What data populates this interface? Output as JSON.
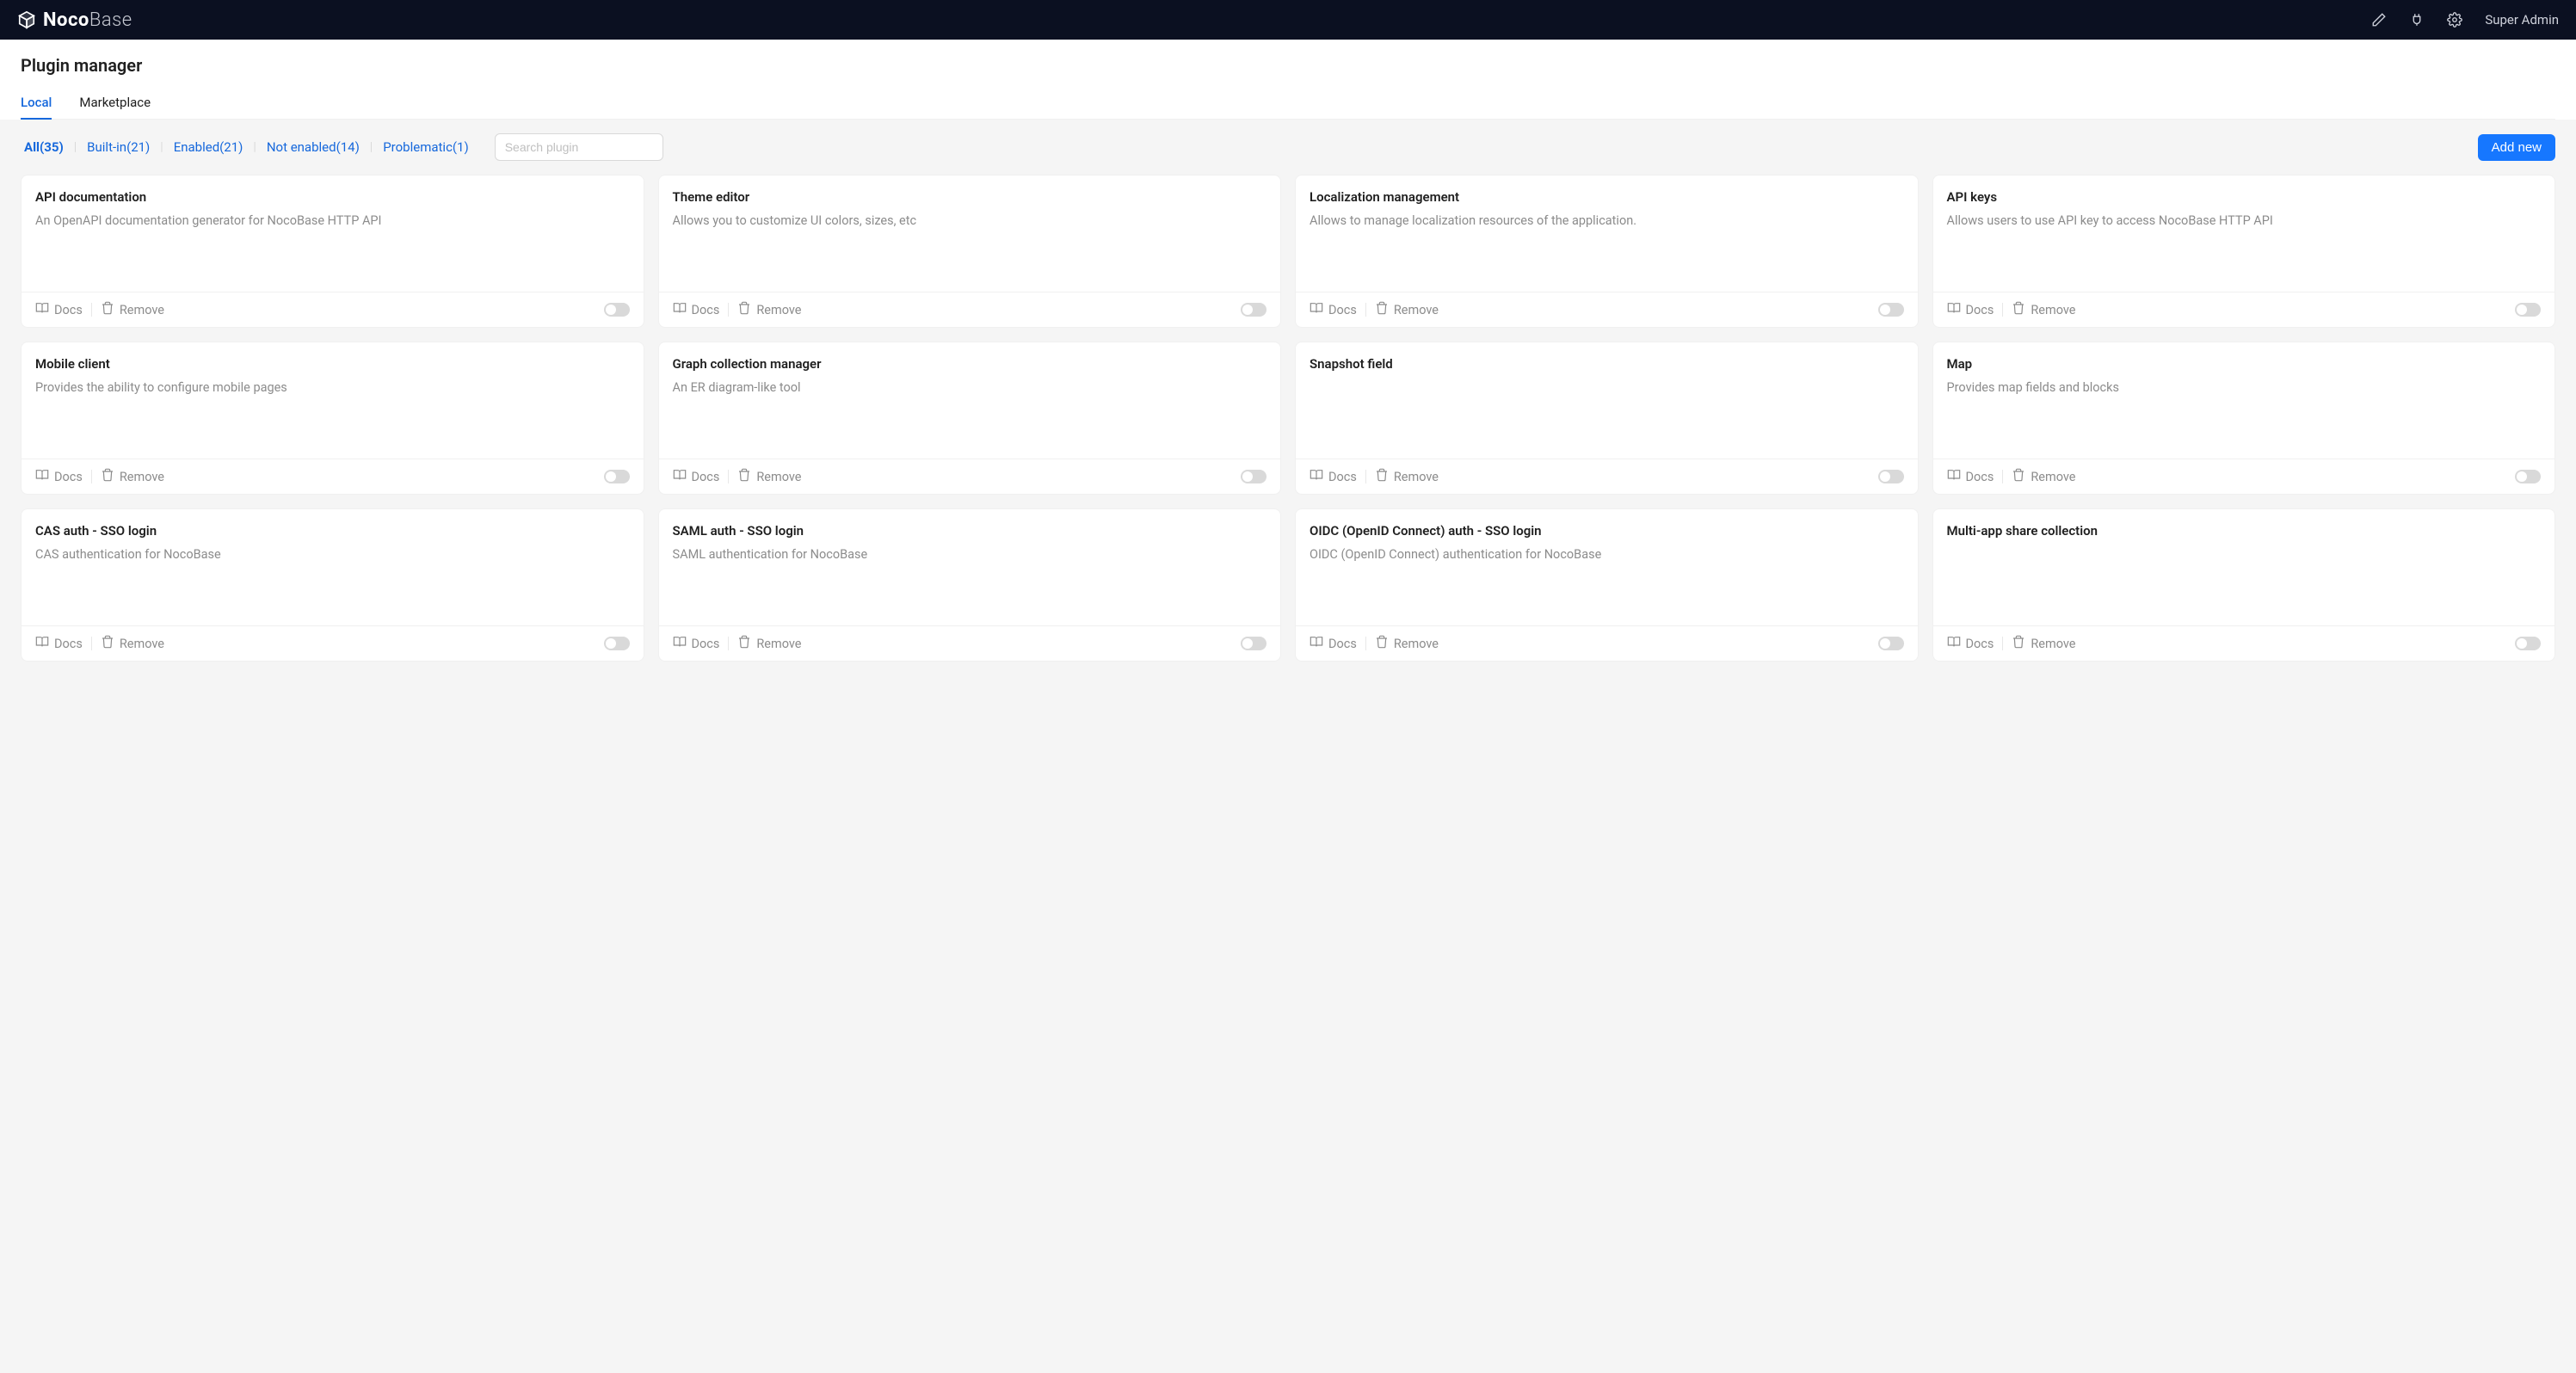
{
  "brand": {
    "noco": "Noco",
    "base": "Base"
  },
  "user": "Super Admin",
  "page_title": "Plugin manager",
  "tabs": {
    "local": "Local",
    "marketplace": "Marketplace"
  },
  "filters": {
    "all": "All(35)",
    "builtin": "Built-in(21)",
    "enabled": "Enabled(21)",
    "not_enabled": "Not enabled(14)",
    "problematic": "Problematic(1)"
  },
  "search_placeholder": "Search plugin",
  "add_new": "Add new",
  "labels": {
    "docs": "Docs",
    "remove": "Remove"
  },
  "plugins": [
    {
      "title": "API documentation",
      "desc": "An OpenAPI documentation generator for NocoBase HTTP API",
      "enabled": false
    },
    {
      "title": "Theme editor",
      "desc": "Allows you to customize UI colors, sizes, etc",
      "enabled": false
    },
    {
      "title": "Localization management",
      "desc": "Allows to manage localization resources of the application.",
      "enabled": false
    },
    {
      "title": "API keys",
      "desc": "Allows users to use API key to access NocoBase HTTP API",
      "enabled": false
    },
    {
      "title": "Mobile client",
      "desc": "Provides the ability to configure mobile pages",
      "enabled": false
    },
    {
      "title": "Graph collection manager",
      "desc": "An ER diagram-like tool",
      "enabled": false
    },
    {
      "title": "Snapshot field",
      "desc": "",
      "enabled": false
    },
    {
      "title": "Map",
      "desc": "Provides map fields and blocks",
      "enabled": false
    },
    {
      "title": "CAS auth - SSO login",
      "desc": "CAS authentication for NocoBase",
      "enabled": false
    },
    {
      "title": "SAML auth - SSO login",
      "desc": "SAML authentication for NocoBase",
      "enabled": false
    },
    {
      "title": "OIDC (OpenID Connect) auth - SSO login",
      "desc": "OIDC (OpenID Connect) authentication for NocoBase",
      "enabled": false
    },
    {
      "title": "Multi-app share collection",
      "desc": "",
      "enabled": false
    }
  ]
}
